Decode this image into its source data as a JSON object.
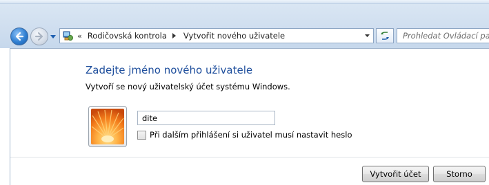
{
  "toolbar": {
    "back_icon": "back-arrow-icon",
    "forward_icon": "forward-arrow-icon",
    "history_icon": "history-dropdown-icon",
    "refresh_icon": "refresh-icon"
  },
  "address_bar": {
    "location_icon": "control-panel-icon",
    "chevrons": "«",
    "breadcrumbs": [
      "Rodičovská kontrola",
      "Vytvořit nového uživatele"
    ]
  },
  "search": {
    "placeholder": "Prohledat Ovládací panely"
  },
  "main": {
    "heading": "Zadejte jméno nového uživatele",
    "subtext": "Vytvoří se nový uživatelský účet systému Windows.",
    "user_picture": "user-picture-flower",
    "username_value": "dite",
    "password_checkbox_label": "Při dalším přihlášení si uživatel musí nastavit heslo",
    "password_checkbox_checked": false
  },
  "buttons": {
    "create": "Vytvořit účet",
    "cancel": "Storno"
  }
}
